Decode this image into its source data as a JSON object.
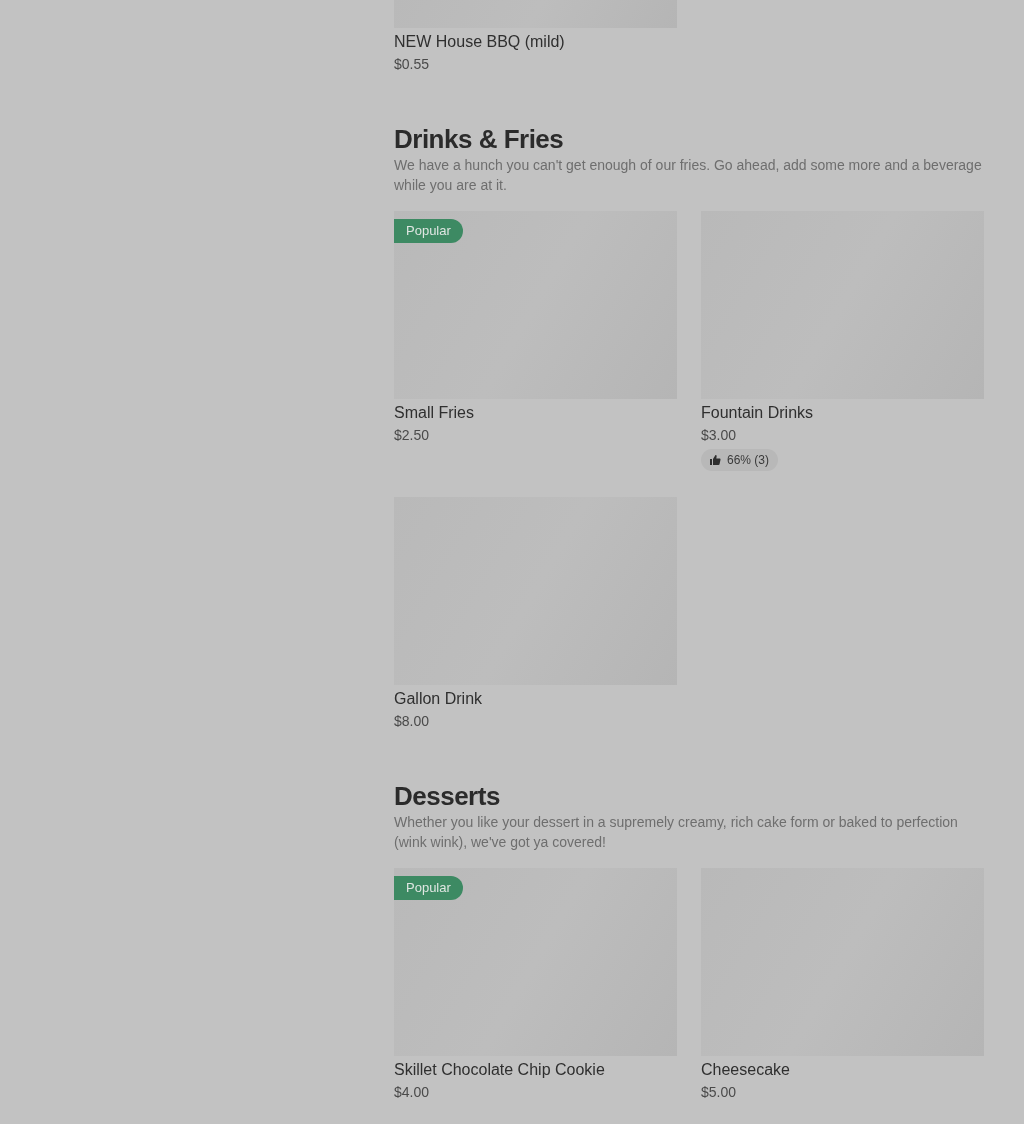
{
  "sections": [
    {
      "items": [
        {
          "kind": "partial",
          "name": "NEW House BBQ (mild)",
          "price": "$0.55"
        }
      ]
    },
    {
      "title": "Drinks & Fries",
      "description": "We have a hunch you can't get enough of our fries. Go ahead, add some more and a beverage while you are at it.",
      "items": [
        {
          "kind": "full",
          "name": "Small Fries",
          "price": "$2.50",
          "badge": "Popular"
        },
        {
          "kind": "full",
          "name": "Fountain Drinks",
          "price": "$3.00",
          "rating": "66% (3)"
        },
        {
          "kind": "full",
          "name": "Gallon Drink",
          "price": "$8.00"
        }
      ]
    },
    {
      "title": "Desserts",
      "description": "Whether you like your dessert in a supremely creamy, rich cake form or baked to perfection (wink wink), we've got ya covered!",
      "items": [
        {
          "kind": "full",
          "name": "Skillet Chocolate Chip Cookie",
          "price": "$4.00",
          "badge": "Popular"
        },
        {
          "kind": "full",
          "name": "Cheesecake",
          "price": "$5.00"
        }
      ]
    }
  ]
}
